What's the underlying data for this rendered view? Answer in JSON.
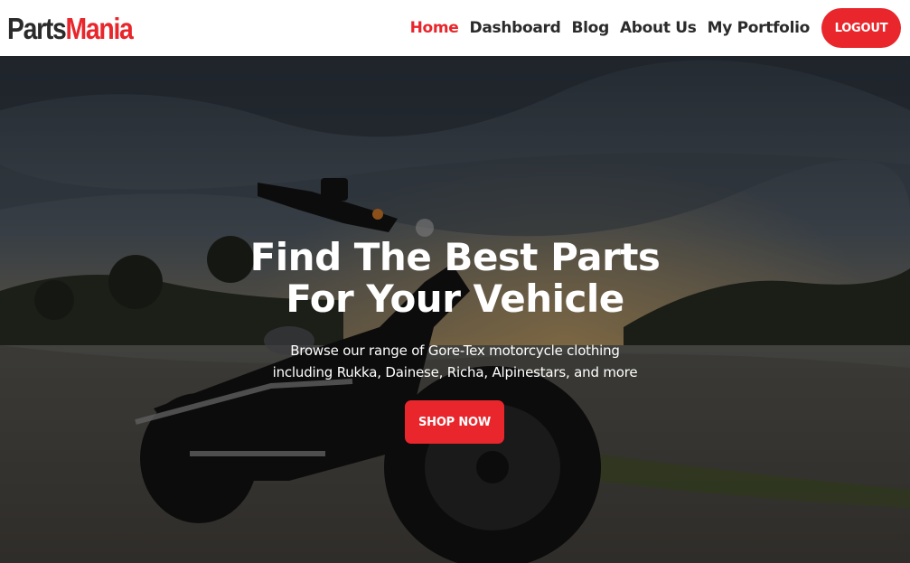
{
  "brand": {
    "part1": "Parts",
    "part2": "Mania"
  },
  "nav": {
    "items": [
      {
        "label": "Home",
        "active": true
      },
      {
        "label": "Dashboard"
      },
      {
        "label": "Blog"
      },
      {
        "label": "About Us"
      },
      {
        "label": "My Portfolio"
      }
    ],
    "logout_label": "LOGOUT"
  },
  "hero": {
    "title_line1": "Find The Best Parts",
    "title_line2": "For Your Vehicle",
    "subtitle_line1": "Browse our range of Gore-Tex motorcycle clothing",
    "subtitle_line2": "including Rukka, Dainese, Richa, Alpinestars, and more",
    "cta_label": "SHOP NOW",
    "background_image": "motorcycle-at-dusk-photo"
  },
  "colors": {
    "accent": "#e8262c",
    "text_dark": "#2b2b2b",
    "header_bg": "#ffffff"
  }
}
